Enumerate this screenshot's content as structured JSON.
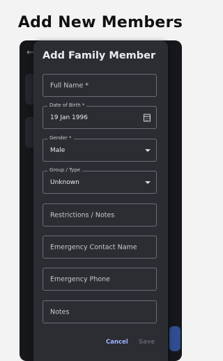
{
  "headline": "Add New Members",
  "dialog": {
    "title": "Add Family Member",
    "fields": [
      {
        "label": "Full Name *"
      },
      {
        "label": "Date of Birth *",
        "value": "19 Jan 1996",
        "icon": "calendar-icon"
      },
      {
        "label": "Gender *",
        "value": "Male",
        "icon": "dropdown-arrow-icon"
      },
      {
        "label": "Group / Type",
        "value": "Unknown",
        "icon": "dropdown-arrow-icon"
      },
      {
        "label": "Restrictions / Notes"
      },
      {
        "label": "Emergency Contact Name"
      },
      {
        "label": "Emergency Phone"
      },
      {
        "label": "Notes"
      }
    ],
    "cancel_label": "Cancel",
    "save_label": "Save"
  },
  "colors": {
    "dialog_bg": "#2c2d33",
    "accent": "#9db4ff",
    "disabled": "#5e6068"
  }
}
